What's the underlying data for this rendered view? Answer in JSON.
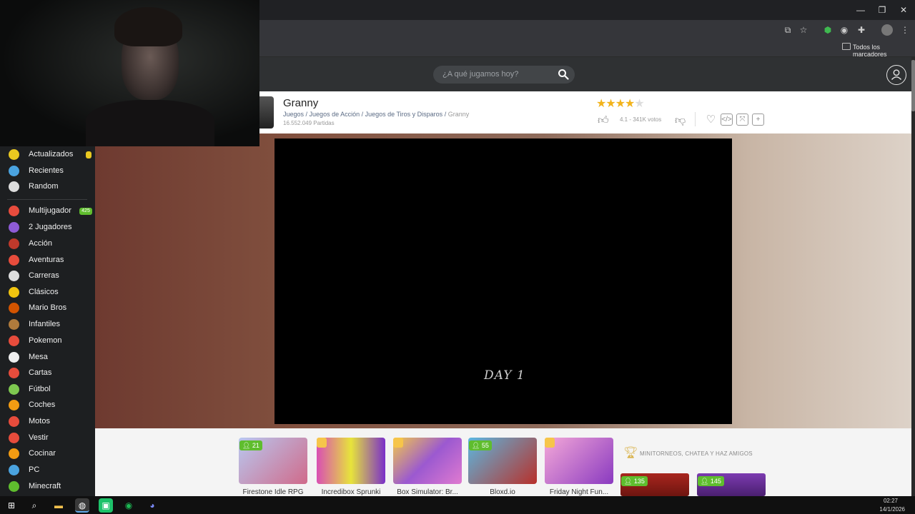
{
  "browser": {
    "bookmarks_label": "Todos los marcadores",
    "window_controls": [
      "—",
      "❐",
      "✕"
    ]
  },
  "header": {
    "search_placeholder": "¿A qué jugamos hoy?"
  },
  "game": {
    "title": "Granny",
    "breadcrumb": [
      "Juegos",
      "Juegos de Acción",
      "Juegos de Tiros y Disparos",
      "Granny"
    ],
    "breadcrumb_sep": " / ",
    "plays": "16.552.049 Partidas",
    "rating_stars": 4,
    "rating_text": "4.1 - 341K votos",
    "screen_text": "DAY 1"
  },
  "sidebar": {
    "items": [
      {
        "label": "Actualizados",
        "icon": "check-icon",
        "color": "#e9c820",
        "badge": "",
        "badge_color": "#e9c820"
      },
      {
        "label": "Recientes",
        "icon": "clock-icon",
        "color": "#4aa3df"
      },
      {
        "label": "Random",
        "icon": "shuffle-icon",
        "color": "#dddddd"
      },
      {
        "label": "Multijugador",
        "icon": "dots-icon",
        "color": "#e84c3d",
        "badge": "425",
        "badge_color": "#5fbd2e"
      },
      {
        "label": "2 Jugadores",
        "icon": "two-players-icon",
        "color": "#8e5bd6"
      },
      {
        "label": "Acción",
        "icon": "swords-icon",
        "color": "#c0392b"
      },
      {
        "label": "Aventuras",
        "icon": "flag-icon",
        "color": "#e74c3c"
      },
      {
        "label": "Carreras",
        "icon": "checkered-flag-icon",
        "color": "#dddddd"
      },
      {
        "label": "Clásicos",
        "icon": "pacman-icon",
        "color": "#f1c40f"
      },
      {
        "label": "Mario Bros",
        "icon": "mario-icon",
        "color": "#d35400"
      },
      {
        "label": "Infantiles",
        "icon": "kids-icon",
        "color": "#b07b3c"
      },
      {
        "label": "Pokemon",
        "icon": "pokeball-icon",
        "color": "#e74c3c"
      },
      {
        "label": "Mesa",
        "icon": "spade-icon",
        "color": "#eeeeee"
      },
      {
        "label": "Cartas",
        "icon": "cards-icon",
        "color": "#e74c3c"
      },
      {
        "label": "Fútbol",
        "icon": "ball-icon",
        "color": "#7ec850"
      },
      {
        "label": "Coches",
        "icon": "car-icon",
        "color": "#f39c12"
      },
      {
        "label": "Motos",
        "icon": "moto-icon",
        "color": "#e74c3c"
      },
      {
        "label": "Vestir",
        "icon": "dress-icon",
        "color": "#e74c3c"
      },
      {
        "label": "Cocinar",
        "icon": "cooking-icon",
        "color": "#f39c12"
      },
      {
        "label": "PC",
        "icon": "pc-icon",
        "color": "#4aa3df"
      },
      {
        "label": "Minecraft",
        "icon": "minecraft-icon",
        "color": "#5fbd2e"
      }
    ]
  },
  "related": {
    "cards": [
      {
        "title": "Firestone Idle RPG",
        "players": "21",
        "bg": "linear-gradient(135deg,#b8c8f0,#d06a8a)"
      },
      {
        "title": "Incredibox Sprunki",
        "players": "",
        "bg": "linear-gradient(90deg,#d94fb3,#e7e43b,#7a2fc9)"
      },
      {
        "title": "Box Simulator: Br...",
        "players": "",
        "bg": "linear-gradient(135deg,#f3c94a,#9b59d0,#e07ad0)"
      },
      {
        "title": "Bloxd.io",
        "players": "55",
        "bg": "linear-gradient(135deg,#5bb8e0,#b8302a)"
      },
      {
        "title": "Friday Night Fun...",
        "players": "",
        "bg": "linear-gradient(135deg,#f4a8d8,#8a3ac0)"
      }
    ],
    "mini_title": "MINITORNEOS, CHATEA Y HAZ AMIGOS",
    "promo": [
      {
        "players": "135",
        "bg": "linear-gradient(#a8261e,#6e1510)"
      },
      {
        "players": "145",
        "bg": "linear-gradient(#7c3bb0,#4a1f70)"
      }
    ]
  },
  "taskbar": {
    "time": "02:27",
    "date": "14/1/2026"
  }
}
